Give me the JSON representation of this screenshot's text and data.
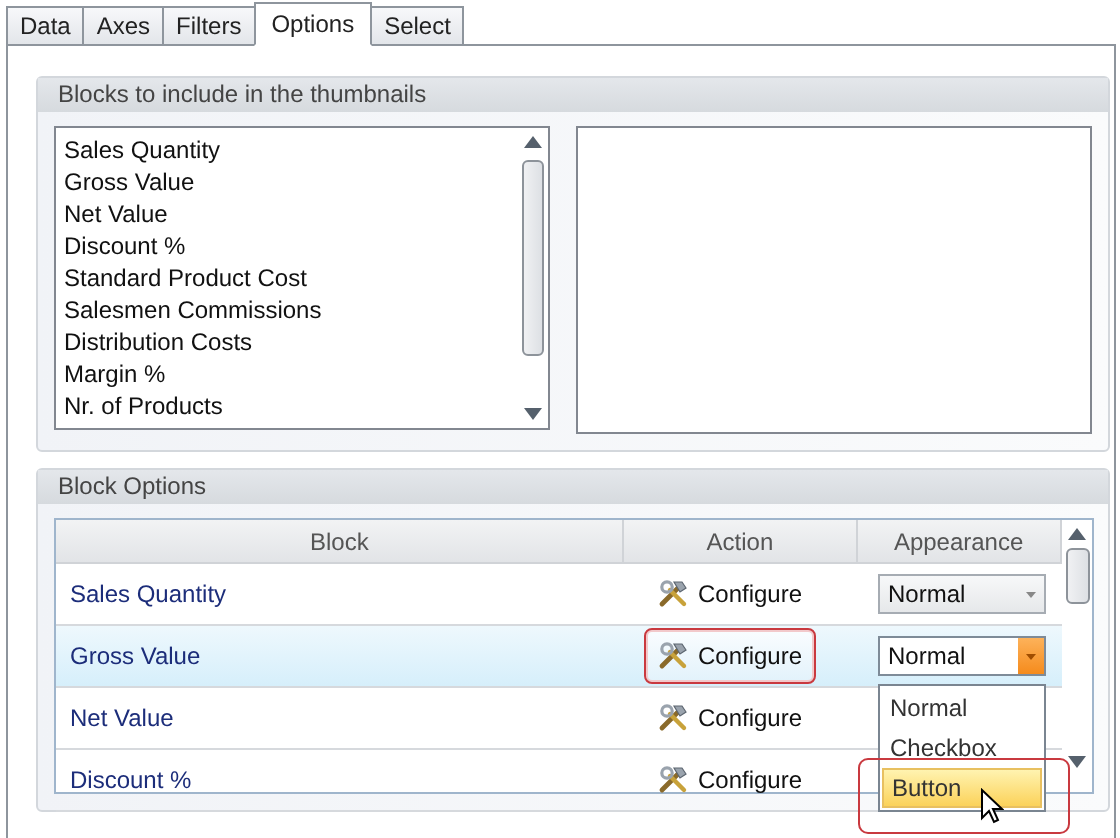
{
  "tabs": [
    {
      "label": "Data",
      "selected": false
    },
    {
      "label": "Axes",
      "selected": false
    },
    {
      "label": "Filters",
      "selected": false
    },
    {
      "label": "Options",
      "selected": true
    },
    {
      "label": "Select",
      "selected": false
    }
  ],
  "thumbnails_group": {
    "title": "Blocks to include in the thumbnails",
    "available": [
      "Sales Quantity",
      "Gross Value",
      "Net Value",
      "Discount %",
      "Standard Product Cost",
      "Salesmen Commissions",
      "Distribution Costs",
      "Margin %",
      "Nr. of Products"
    ]
  },
  "block_options": {
    "title": "Block Options",
    "columns": [
      "Block",
      "Action",
      "Appearance"
    ],
    "rows": [
      {
        "block": "Sales Quantity",
        "action": "Configure",
        "action_annotated": false,
        "selected": false,
        "appearance": {
          "value": "Normal",
          "open": false
        }
      },
      {
        "block": "Gross Value",
        "action": "Configure",
        "action_annotated": true,
        "selected": true,
        "appearance": {
          "value": "Normal",
          "open": true,
          "options": [
            {
              "label": "Normal",
              "highlighted": false,
              "annotated": false
            },
            {
              "label": "Checkbox",
              "highlighted": false,
              "annotated": false
            },
            {
              "label": "Button",
              "highlighted": true,
              "annotated": true
            }
          ]
        }
      },
      {
        "block": "Net Value",
        "action": "Configure",
        "action_annotated": false,
        "selected": false
      },
      {
        "block": "Discount %",
        "action": "Configure",
        "action_annotated": false,
        "selected": false
      }
    ]
  }
}
